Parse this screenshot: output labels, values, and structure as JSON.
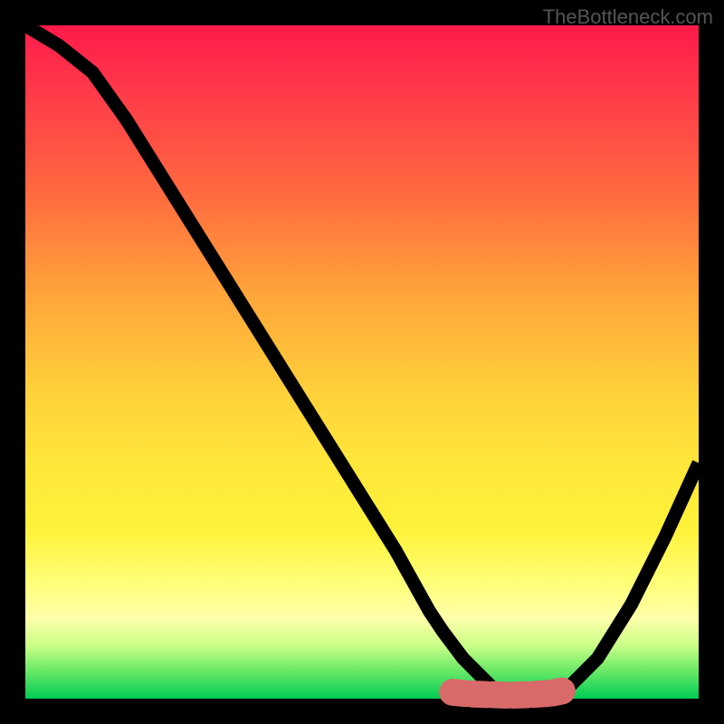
{
  "watermark": "TheBottleneck.com",
  "chart_data": {
    "type": "line",
    "title": "",
    "xlabel": "",
    "ylabel": "",
    "xlim": [
      0,
      100
    ],
    "ylim": [
      0,
      100
    ],
    "series": [
      {
        "name": "bottleneck-curve",
        "x": [
          0,
          5,
          10,
          15,
          20,
          25,
          30,
          35,
          40,
          45,
          50,
          55,
          60,
          62,
          65,
          68,
          70,
          72,
          74,
          76,
          78,
          80,
          85,
          90,
          95,
          100
        ],
        "y": [
          100,
          97,
          93,
          86,
          78,
          70,
          62,
          54,
          46,
          38,
          30,
          22,
          13,
          10,
          6,
          3,
          1,
          0.5,
          0.3,
          0.3,
          0.5,
          1,
          6,
          14,
          24,
          35
        ]
      }
    ],
    "optimal_range": {
      "start": 62,
      "end": 80,
      "y": 0.8
    },
    "markers": {
      "x": [
        63,
        66,
        69,
        72,
        75,
        78,
        80
      ],
      "y": [
        1.0,
        0.7,
        0.6,
        0.5,
        0.6,
        0.8,
        1.2
      ]
    }
  },
  "colors": {
    "gradient_top": "#ff1a4a",
    "gradient_bottom": "#00cc55",
    "curve": "#000000",
    "marker": "#d96a6a",
    "background": "#000000"
  }
}
